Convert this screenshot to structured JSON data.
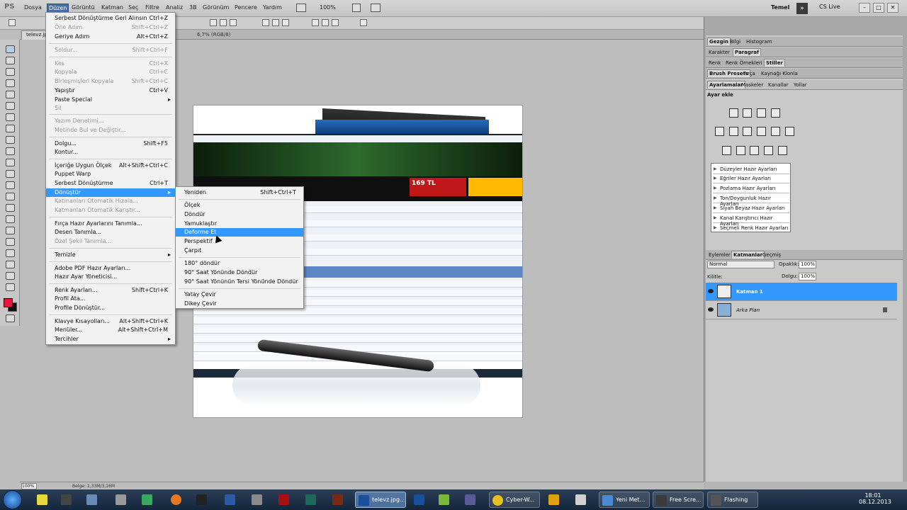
{
  "menubar": {
    "logo": "PS",
    "items": [
      "Dosya",
      "Düzen",
      "Görüntü",
      "Katman",
      "Seç",
      "Filtre",
      "Analiz",
      "3B",
      "Görünüm",
      "Pencere",
      "Yardım"
    ],
    "zoom": "100%",
    "workspace": "Temel",
    "cslive": "CS Live"
  },
  "tab": {
    "doc_name": "televz.jpg",
    "doc_info": "6,7% (RGB/8)"
  },
  "edit_menu": {
    "items": [
      {
        "label": "Serbest Dönüştürme Geri Alınsın",
        "shortcut": "Ctrl+Z",
        "disabled": false
      },
      {
        "label": "Öne Adım",
        "shortcut": "Shift+Ctrl+Z",
        "disabled": true
      },
      {
        "label": "Geriye Adım",
        "shortcut": "Alt+Ctrl+Z",
        "disabled": false
      },
      {
        "label": "Soldur...",
        "shortcut": "Shift+Ctrl+F",
        "disabled": true
      },
      {
        "label": "Kes",
        "shortcut": "Ctrl+X",
        "disabled": true
      },
      {
        "label": "Kopyala",
        "shortcut": "Ctrl+C",
        "disabled": true
      },
      {
        "label": "Birleşmişleri Kopyala",
        "shortcut": "Shift+Ctrl+C",
        "disabled": true
      },
      {
        "label": "Yapıştır",
        "shortcut": "Ctrl+V",
        "disabled": false
      },
      {
        "label": "Paste Special",
        "shortcut": "",
        "disabled": false,
        "submenu": true
      },
      {
        "label": "Sil",
        "shortcut": "",
        "disabled": true
      },
      {
        "label": "Yazım Denetimi...",
        "shortcut": "",
        "disabled": true
      },
      {
        "label": "Metinde Bul ve Değiştir...",
        "shortcut": "",
        "disabled": true
      },
      {
        "label": "Dolgu...",
        "shortcut": "Shift+F5",
        "disabled": false
      },
      {
        "label": "Kontur...",
        "shortcut": "",
        "disabled": false
      },
      {
        "label": "İçeriğe Uygun Ölçek",
        "shortcut": "Alt+Shift+Ctrl+C",
        "disabled": false
      },
      {
        "label": "Puppet Warp",
        "shortcut": "",
        "disabled": false
      },
      {
        "label": "Serbest Dönüştürme",
        "shortcut": "Ctrl+T",
        "disabled": false
      },
      {
        "label": "Dönüştür",
        "shortcut": "",
        "disabled": false,
        "submenu": true,
        "highlight": true
      },
      {
        "label": "Katmanları Otomatik Hizala...",
        "shortcut": "",
        "disabled": true
      },
      {
        "label": "Katmanları Otomatik Karıştır...",
        "shortcut": "",
        "disabled": true
      },
      {
        "label": "Fırça Hazır Ayarlarını Tanımla...",
        "shortcut": "",
        "disabled": false
      },
      {
        "label": "Desen Tanımla...",
        "shortcut": "",
        "disabled": false
      },
      {
        "label": "Özel Şekil Tanımla...",
        "shortcut": "",
        "disabled": true
      },
      {
        "label": "Temizle",
        "shortcut": "",
        "disabled": false,
        "submenu": true
      },
      {
        "label": "Adobe PDF Hazır Ayarları...",
        "shortcut": "",
        "disabled": false
      },
      {
        "label": "Hazır Ayar Yöneticisi...",
        "shortcut": "",
        "disabled": false
      },
      {
        "label": "Renk Ayarları...",
        "shortcut": "Shift+Ctrl+K",
        "disabled": false
      },
      {
        "label": "Profil Ata...",
        "shortcut": "",
        "disabled": false
      },
      {
        "label": "Profile Dönüştür...",
        "shortcut": "",
        "disabled": false
      },
      {
        "label": "Klavye Kısayolları...",
        "shortcut": "Alt+Shift+Ctrl+K",
        "disabled": false
      },
      {
        "label": "Menüler...",
        "shortcut": "Alt+Shift+Ctrl+M",
        "disabled": false
      },
      {
        "label": "Tercihler",
        "shortcut": "",
        "disabled": false,
        "submenu": true
      }
    ]
  },
  "transform_submenu": {
    "items": [
      {
        "label": "Yeniden",
        "shortcut": "Shift+Ctrl+T"
      },
      {
        "label": "Ölçek",
        "shortcut": ""
      },
      {
        "label": "Döndür",
        "shortcut": ""
      },
      {
        "label": "Yamuklaştır",
        "shortcut": ""
      },
      {
        "label": "Deforme Et",
        "shortcut": "",
        "highlight": true
      },
      {
        "label": "Perspektif",
        "shortcut": ""
      },
      {
        "label": "Çarpıt",
        "shortcut": ""
      },
      {
        "label": "180° döndür",
        "shortcut": ""
      },
      {
        "label": "90° Saat Yönünde Döndür",
        "shortcut": ""
      },
      {
        "label": "90° Saat Yönünün Tersi Yönünde Döndür",
        "shortcut": ""
      },
      {
        "label": "Yatay Çevir",
        "shortcut": ""
      },
      {
        "label": "Dikey Çevir",
        "shortcut": ""
      }
    ]
  },
  "document": {
    "banner_text": "169 TL"
  },
  "panels": {
    "row1": [
      "Gezgin",
      "Bilgi",
      "Histogram"
    ],
    "row2": [
      "Karakter",
      "Paragraf"
    ],
    "row3": [
      "Renk",
      "Renk Örnekleri",
      "Stiller"
    ],
    "row4": [
      "Brush Presets",
      "Fırça",
      "Kaynağı Klonla"
    ],
    "row5": [
      "Ayarlamalar",
      "Maskeler",
      "Kanallar",
      "Yollar"
    ],
    "adjust_title": "Ayar ekle",
    "presets": [
      "Düzeyler Hazır Ayarları",
      "Eğriler Hazır Ayarları",
      "Pozlama Hazır Ayarları",
      "Ton/Doygunluk Hazır Ayarları",
      "Siyah Beyaz Hazır Ayarları",
      "Kanal Karıştırıcı Hazır Ayarları",
      "Seçmeli Renk Hazır Ayarları"
    ]
  },
  "layers": {
    "tabs": [
      "Eylemler",
      "Katmanlar",
      "Geçmiş"
    ],
    "blend_mode": "Normal",
    "opacity_label": "Opaklık:",
    "opacity": "100%",
    "lock_label": "Kilitle:",
    "fill_label": "Dolgu:",
    "fill": "100%",
    "items": [
      {
        "name": "Katman 1",
        "selected": true
      },
      {
        "name": "Arka Plan",
        "selected": false
      }
    ]
  },
  "statusbar": {
    "zoom": "100%",
    "docsize": "Belge: 1,33M/3,16M"
  },
  "taskbar": {
    "items": [
      {
        "label": "televz.jpg...",
        "icon_color": "#1a4f9c"
      },
      {
        "label": "Cyber-W...",
        "icon_color": "#ffffff"
      },
      {
        "label": "Yeni Met...",
        "icon_color": "#4a8ad4"
      },
      {
        "label": "Free Scre...",
        "icon_color": "#3a3a3a"
      },
      {
        "label": "Flashing",
        "icon_color": "#555555"
      }
    ],
    "time": "18:01",
    "date": "08.12.2013"
  }
}
